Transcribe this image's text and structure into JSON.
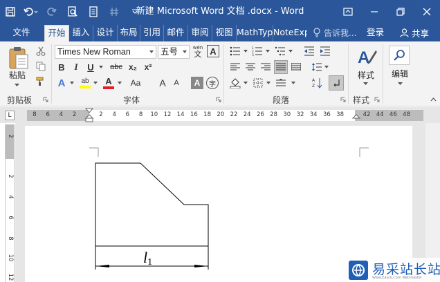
{
  "window": {
    "title": "新建 Microsoft Word 文档 .docx - Word"
  },
  "tabs": [
    {
      "label": "文件"
    },
    {
      "label": "开始"
    },
    {
      "label": "插入"
    },
    {
      "label": "设计"
    },
    {
      "label": "布局"
    },
    {
      "label": "引用"
    },
    {
      "label": "邮件"
    },
    {
      "label": "审阅"
    },
    {
      "label": "视图"
    },
    {
      "label": "MathType"
    },
    {
      "label": "NoteExpress"
    }
  ],
  "header": {
    "tell_me_placeholder": "告诉我...",
    "login_label": "登录",
    "share_label": "共享"
  },
  "ribbon": {
    "clipboard": {
      "paste_label": "粘贴",
      "group_label": "剪贴板"
    },
    "font": {
      "font_name": "Times New Roman",
      "font_size": "五号",
      "phonetic_glyph": "wén",
      "border_glyph": "A",
      "bold": "B",
      "italic": "I",
      "underline": "U",
      "strike": "abc",
      "subscript": "x₂",
      "superscript": "x²",
      "text_effect": "A",
      "highlight": "ab",
      "font_color": "A",
      "grow_font": "A",
      "shrink_font": "A",
      "char_shading": "A",
      "enclosed_char": "字",
      "change_case": "Aa",
      "group_label": "字体"
    },
    "paragraph": {
      "group_label": "段落"
    },
    "styles": {
      "styles_label": "样式",
      "group_label": "样式"
    },
    "editing": {
      "editing_label": "编辑"
    }
  },
  "ruler": {
    "h_labels": [
      "8",
      "6",
      "4",
      "2",
      "2",
      "4",
      "6",
      "8",
      "10",
      "12",
      "14",
      "16",
      "18",
      "20",
      "22",
      "24",
      "26",
      "28",
      "30",
      "32",
      "34",
      "36",
      "38",
      "42",
      "44",
      "46",
      "48"
    ],
    "v_labels": [
      "2",
      "2",
      "4",
      "6",
      "8",
      "10",
      "12"
    ],
    "corner": "L"
  },
  "document": {
    "dimension_label_base": "l",
    "dimension_label_sub": "1"
  },
  "watermark": {
    "text": "易采站长站",
    "sub": "Www.Easck.Com Webmaster"
  },
  "colors": {
    "accent": "#2b579a",
    "ribbon_bg": "#f3f3f3",
    "canvas_bg": "#e6e6e6",
    "font_color_red": "#e51c23",
    "highlight_yellow": "#ffff00"
  }
}
